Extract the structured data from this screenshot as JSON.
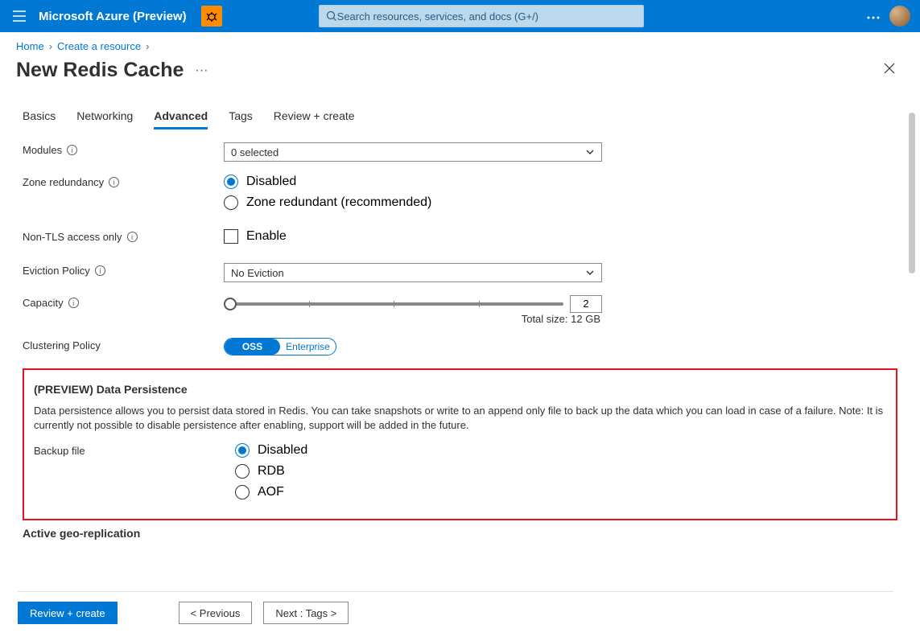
{
  "header": {
    "brand": "Microsoft Azure (Preview)",
    "search_placeholder": "Search resources, services, and docs (G+/)"
  },
  "breadcrumbs": {
    "home": "Home",
    "create": "Create a resource"
  },
  "page": {
    "title": "New Redis Cache"
  },
  "tabs": {
    "basics": "Basics",
    "networking": "Networking",
    "advanced": "Advanced",
    "tags": "Tags",
    "review": "Review + create"
  },
  "form": {
    "modules": {
      "label": "Modules",
      "value": "0 selected"
    },
    "zone": {
      "label": "Zone redundancy",
      "options": {
        "disabled": "Disabled",
        "redundant": "Zone redundant (recommended)"
      },
      "selected": "disabled"
    },
    "nontls": {
      "label": "Non-TLS access only",
      "option": "Enable",
      "checked": false
    },
    "eviction": {
      "label": "Eviction Policy",
      "value": "No Eviction"
    },
    "capacity": {
      "label": "Capacity",
      "value": "2",
      "total": "Total size: 12 GB"
    },
    "clustering": {
      "label": "Clustering Policy",
      "options": {
        "oss": "OSS",
        "enterprise": "Enterprise"
      },
      "selected": "oss"
    }
  },
  "persistence": {
    "heading": "(PREVIEW) Data Persistence",
    "description": "Data persistence allows you to persist data stored in Redis. You can take snapshots or write to an append only file to back up the data which you can load in case of a failure. Note: It is currently not possible to disable persistence after enabling, support will be added in the future.",
    "backup": {
      "label": "Backup file",
      "options": {
        "disabled": "Disabled",
        "rdb": "RDB",
        "aof": "AOF"
      },
      "selected": "disabled"
    }
  },
  "georep": {
    "heading": "Active geo-replication"
  },
  "footer": {
    "review": "Review + create",
    "previous": "<  Previous",
    "next": "Next : Tags  >"
  }
}
